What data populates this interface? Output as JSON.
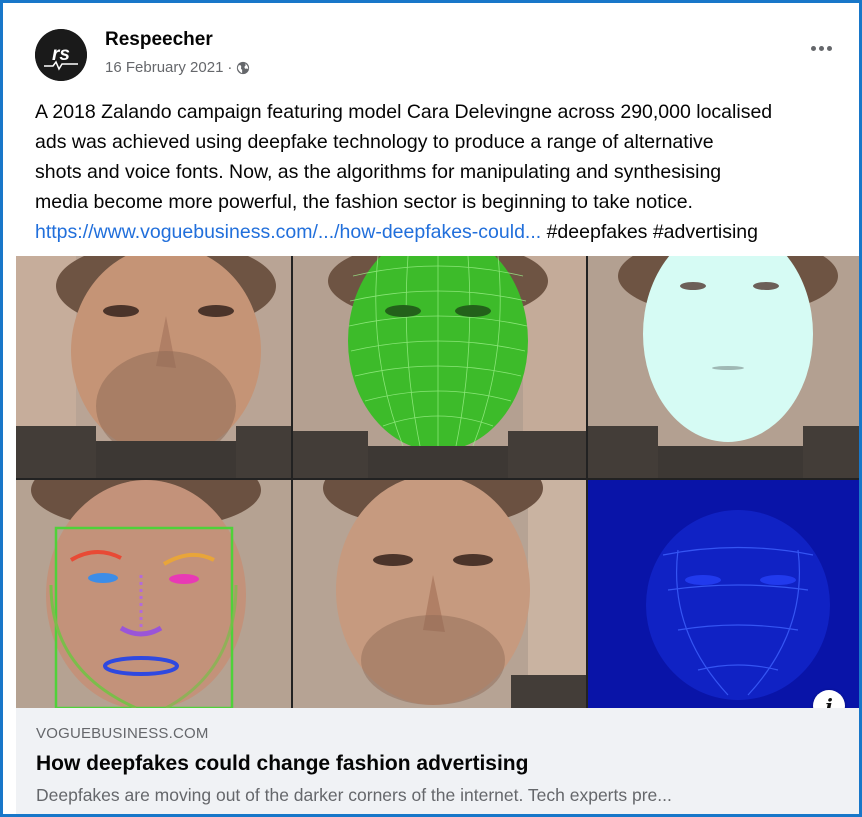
{
  "post": {
    "author": "Respeecher",
    "avatar_initials": "rs",
    "date": "16 February 2021",
    "separator": "·",
    "audience_icon": "globe-icon",
    "more_icon": "more-options-icon",
    "text_lines": [
      "A 2018 Zalando campaign featuring model Cara Delevingne across 290,000 localised",
      "ads was achieved using deepfake technology to produce a range of alternative",
      "shots and voice fonts. Now, as the algorithms for manipulating and synthesising",
      "media become more powerful, the fashion sector is beginning to take notice."
    ],
    "link_text": "https://www.voguebusiness.com/.../how-deepfakes-could...",
    "hashtags": " #deepfakes #advertising"
  },
  "link_preview": {
    "domain": "VOGUEBUSINESS.COM",
    "headline": "How deepfakes could change fashion advertising",
    "description": "Deepfakes are moving out of the darker corners of the internet. Tech experts pre...",
    "info_icon": "info-icon",
    "info_label": "i"
  },
  "colors": {
    "border": "#1877c9",
    "link": "#216fdb",
    "preview_bg": "#f0f2f5",
    "muted_text": "#65676b"
  }
}
